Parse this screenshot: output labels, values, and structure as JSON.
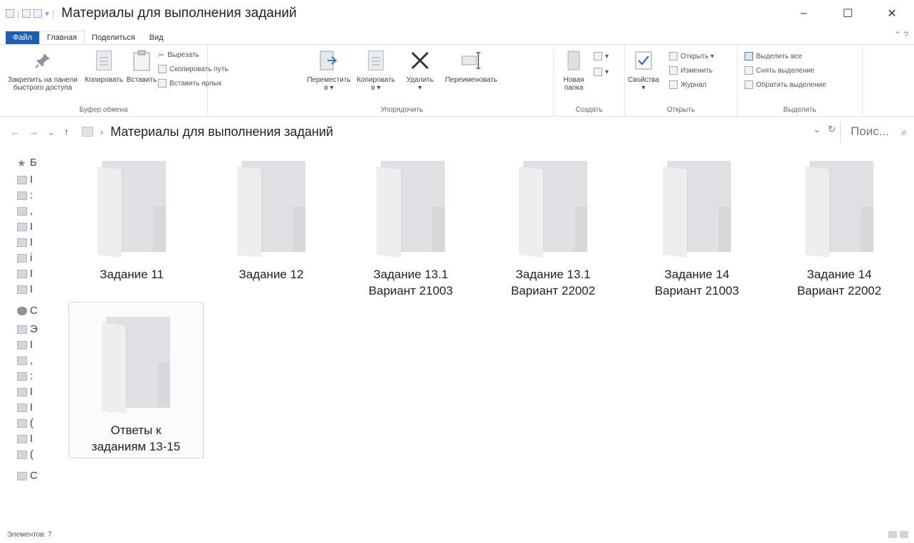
{
  "window": {
    "title": "Материалы для выполнения заданий",
    "minimize": "–",
    "maximize": "☐",
    "close": "✕"
  },
  "tabs": [
    {
      "label": "Файл"
    },
    {
      "label": "Главная"
    },
    {
      "label": "Поделиться"
    },
    {
      "label": "Вид"
    }
  ],
  "ribbon": {
    "clipboard": {
      "label": "Буфер обмена",
      "pin": "Закрепить на панели быстрого доступа",
      "pin_line1": "Закрепить на панели",
      "pin_line2": "быстрого доступа",
      "copy": "Копировать",
      "paste": "Вставить",
      "cut": "Вырезать",
      "copy_path": "Скопировать путь",
      "paste_shortcut": "Вставить ярлык"
    },
    "organize": {
      "label": "Упорядочить",
      "move_line1": "Переместить",
      "move_line2": "в ▾",
      "copy_line1": "Копировать",
      "copy_line2": "в ▾",
      "delete": "Удалить",
      "rename": "Переименовать"
    },
    "create": {
      "label": "Создать",
      "new_folder_line1": "Новая",
      "new_folder_line2": "папка"
    },
    "open": {
      "label": "Открыть",
      "properties": "Свойства",
      "open": "Открыть ▾",
      "edit": "Изменить",
      "history": "Журнал"
    },
    "select": {
      "label": "Выделить",
      "select_all": "Выделить все",
      "select_none": "Снять выделение",
      "invert": "Обратить выделение"
    }
  },
  "address": {
    "path": "Материалы для выполнения заданий",
    "search_placeholder": "Поис..."
  },
  "navpane": [
    {
      "label": "Б"
    },
    {
      "label": "I"
    },
    {
      "label": ":"
    },
    {
      "label": ","
    },
    {
      "label": "I"
    },
    {
      "label": "I"
    },
    {
      "label": "i"
    },
    {
      "label": "I"
    },
    {
      "label": "I"
    },
    {
      "label": "C"
    },
    {
      "label": "Э"
    },
    {
      "label": "I"
    },
    {
      "label": ","
    },
    {
      "label": ":"
    },
    {
      "label": "I"
    },
    {
      "label": "I"
    },
    {
      "label": "("
    },
    {
      "label": "I"
    },
    {
      "label": "("
    },
    {
      "label": "C"
    }
  ],
  "items": [
    {
      "line1": "Задание 11",
      "line2": ""
    },
    {
      "line1": "Задание 12",
      "line2": ""
    },
    {
      "line1": "Задание 13.1",
      "line2": "Вариант 21003"
    },
    {
      "line1": "Задание 13.1",
      "line2": "Вариант 22002"
    },
    {
      "line1": "Задание 14",
      "line2": "Вариант 21003"
    },
    {
      "line1": "Задание 14",
      "line2": "Вариант 22002"
    },
    {
      "line1": "Ответы к",
      "line2": "заданиям 13-15"
    }
  ],
  "status": {
    "count": "Элементов: 7"
  }
}
